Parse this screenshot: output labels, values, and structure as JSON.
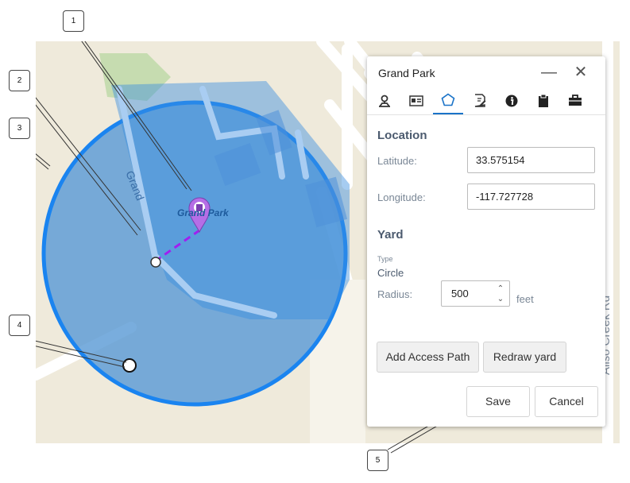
{
  "map": {
    "park_label": "Grand Park",
    "street_grand": "Grand",
    "street_aliso": "Aliso Creek Rd"
  },
  "callouts": [
    "1",
    "2",
    "3",
    "4",
    "5"
  ],
  "panel": {
    "title": "Grand Park",
    "minimize_icon": "minus-icon",
    "close_icon": "close-icon",
    "tabs": [
      {
        "name": "map-pin-tab",
        "icon": "pin-icon"
      },
      {
        "name": "contact-card-tab",
        "icon": "id-card-icon"
      },
      {
        "name": "yard-shape-tab",
        "icon": "pentagon-icon",
        "active": true
      },
      {
        "name": "notes-tab",
        "icon": "note-edit-icon"
      },
      {
        "name": "info-tab",
        "icon": "info-icon"
      },
      {
        "name": "clipboard-tab",
        "icon": "clipboard-icon"
      },
      {
        "name": "briefcase-tab",
        "icon": "briefcase-icon"
      }
    ],
    "location": {
      "title": "Location",
      "latitude_label": "Latitude:",
      "latitude_value": "33.575154",
      "longitude_label": "Longitude:",
      "longitude_value": "-117.727728"
    },
    "yard": {
      "title": "Yard",
      "type_label": "Type",
      "type_value": "Circle",
      "radius_label": "Radius:",
      "radius_value": "500",
      "radius_unit": "feet"
    },
    "buttons": {
      "add_access_path": "Add Access Path",
      "redraw_yard": "Redraw yard",
      "save": "Save",
      "cancel": "Cancel"
    }
  },
  "colors": {
    "circle_fill": "#5b9bd5",
    "circle_stroke": "#1a84f0",
    "park_fill": "#3a8fe0",
    "marker": "#b56ee6",
    "access_path": "#a020f0",
    "accent": "#1a73c8"
  }
}
